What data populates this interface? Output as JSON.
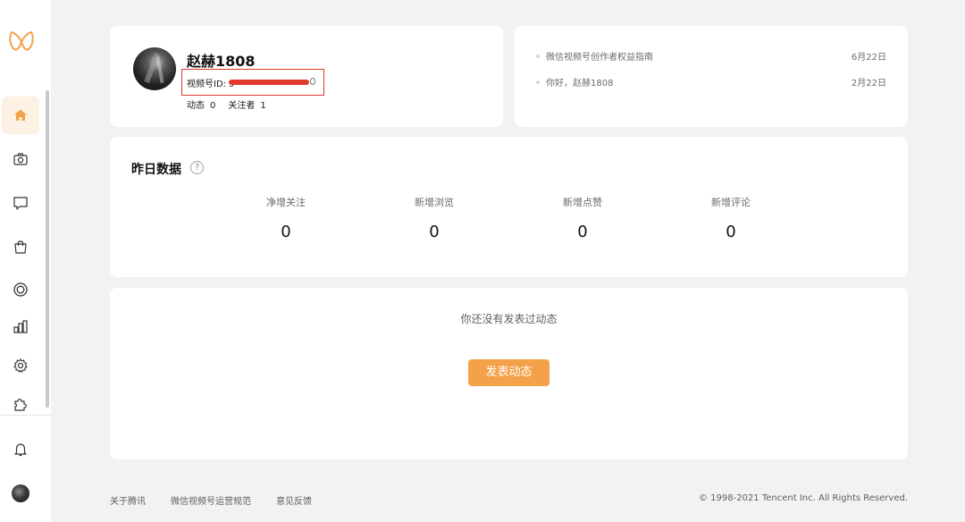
{
  "brand": {
    "accent": "#f3a24a",
    "highlight_border": "#d9362b"
  },
  "sidebar": {
    "items": [
      {
        "name": "home-icon",
        "active": true
      },
      {
        "name": "camera-icon",
        "active": false
      },
      {
        "name": "message-icon",
        "active": false
      },
      {
        "name": "shopping-bag-icon",
        "active": false
      },
      {
        "name": "live-circle-icon",
        "active": false
      },
      {
        "name": "bar-chart-icon",
        "active": false
      },
      {
        "name": "gear-icon",
        "active": false
      },
      {
        "name": "puzzle-icon",
        "active": false
      },
      {
        "name": "bell-icon",
        "active": false
      }
    ]
  },
  "profile": {
    "username": "赵赫1808",
    "id_label": "视频号ID: s",
    "posts_label": "动态",
    "posts_count": "0",
    "followers_label": "关注者",
    "followers_count": "1"
  },
  "notices": [
    {
      "text": "微信视频号创作者权益指南",
      "date": "6月22日"
    },
    {
      "text": "你好，赵赫1808",
      "date": "2月22日"
    }
  ],
  "stats": {
    "title": "昨日数据",
    "help": "?",
    "items": [
      {
        "label": "净增关注",
        "value": "0"
      },
      {
        "label": "新增浏览",
        "value": "0"
      },
      {
        "label": "新增点赞",
        "value": "0"
      },
      {
        "label": "新增评论",
        "value": "0"
      }
    ]
  },
  "posts": {
    "empty_text": "你还没有发表过动态",
    "button_label": "发表动态"
  },
  "footer": {
    "links": [
      "关于腾讯",
      "微信视频号运营规范",
      "意见反馈"
    ],
    "copyright": "© 1998-2021 Tencent Inc. All Rights Reserved."
  }
}
